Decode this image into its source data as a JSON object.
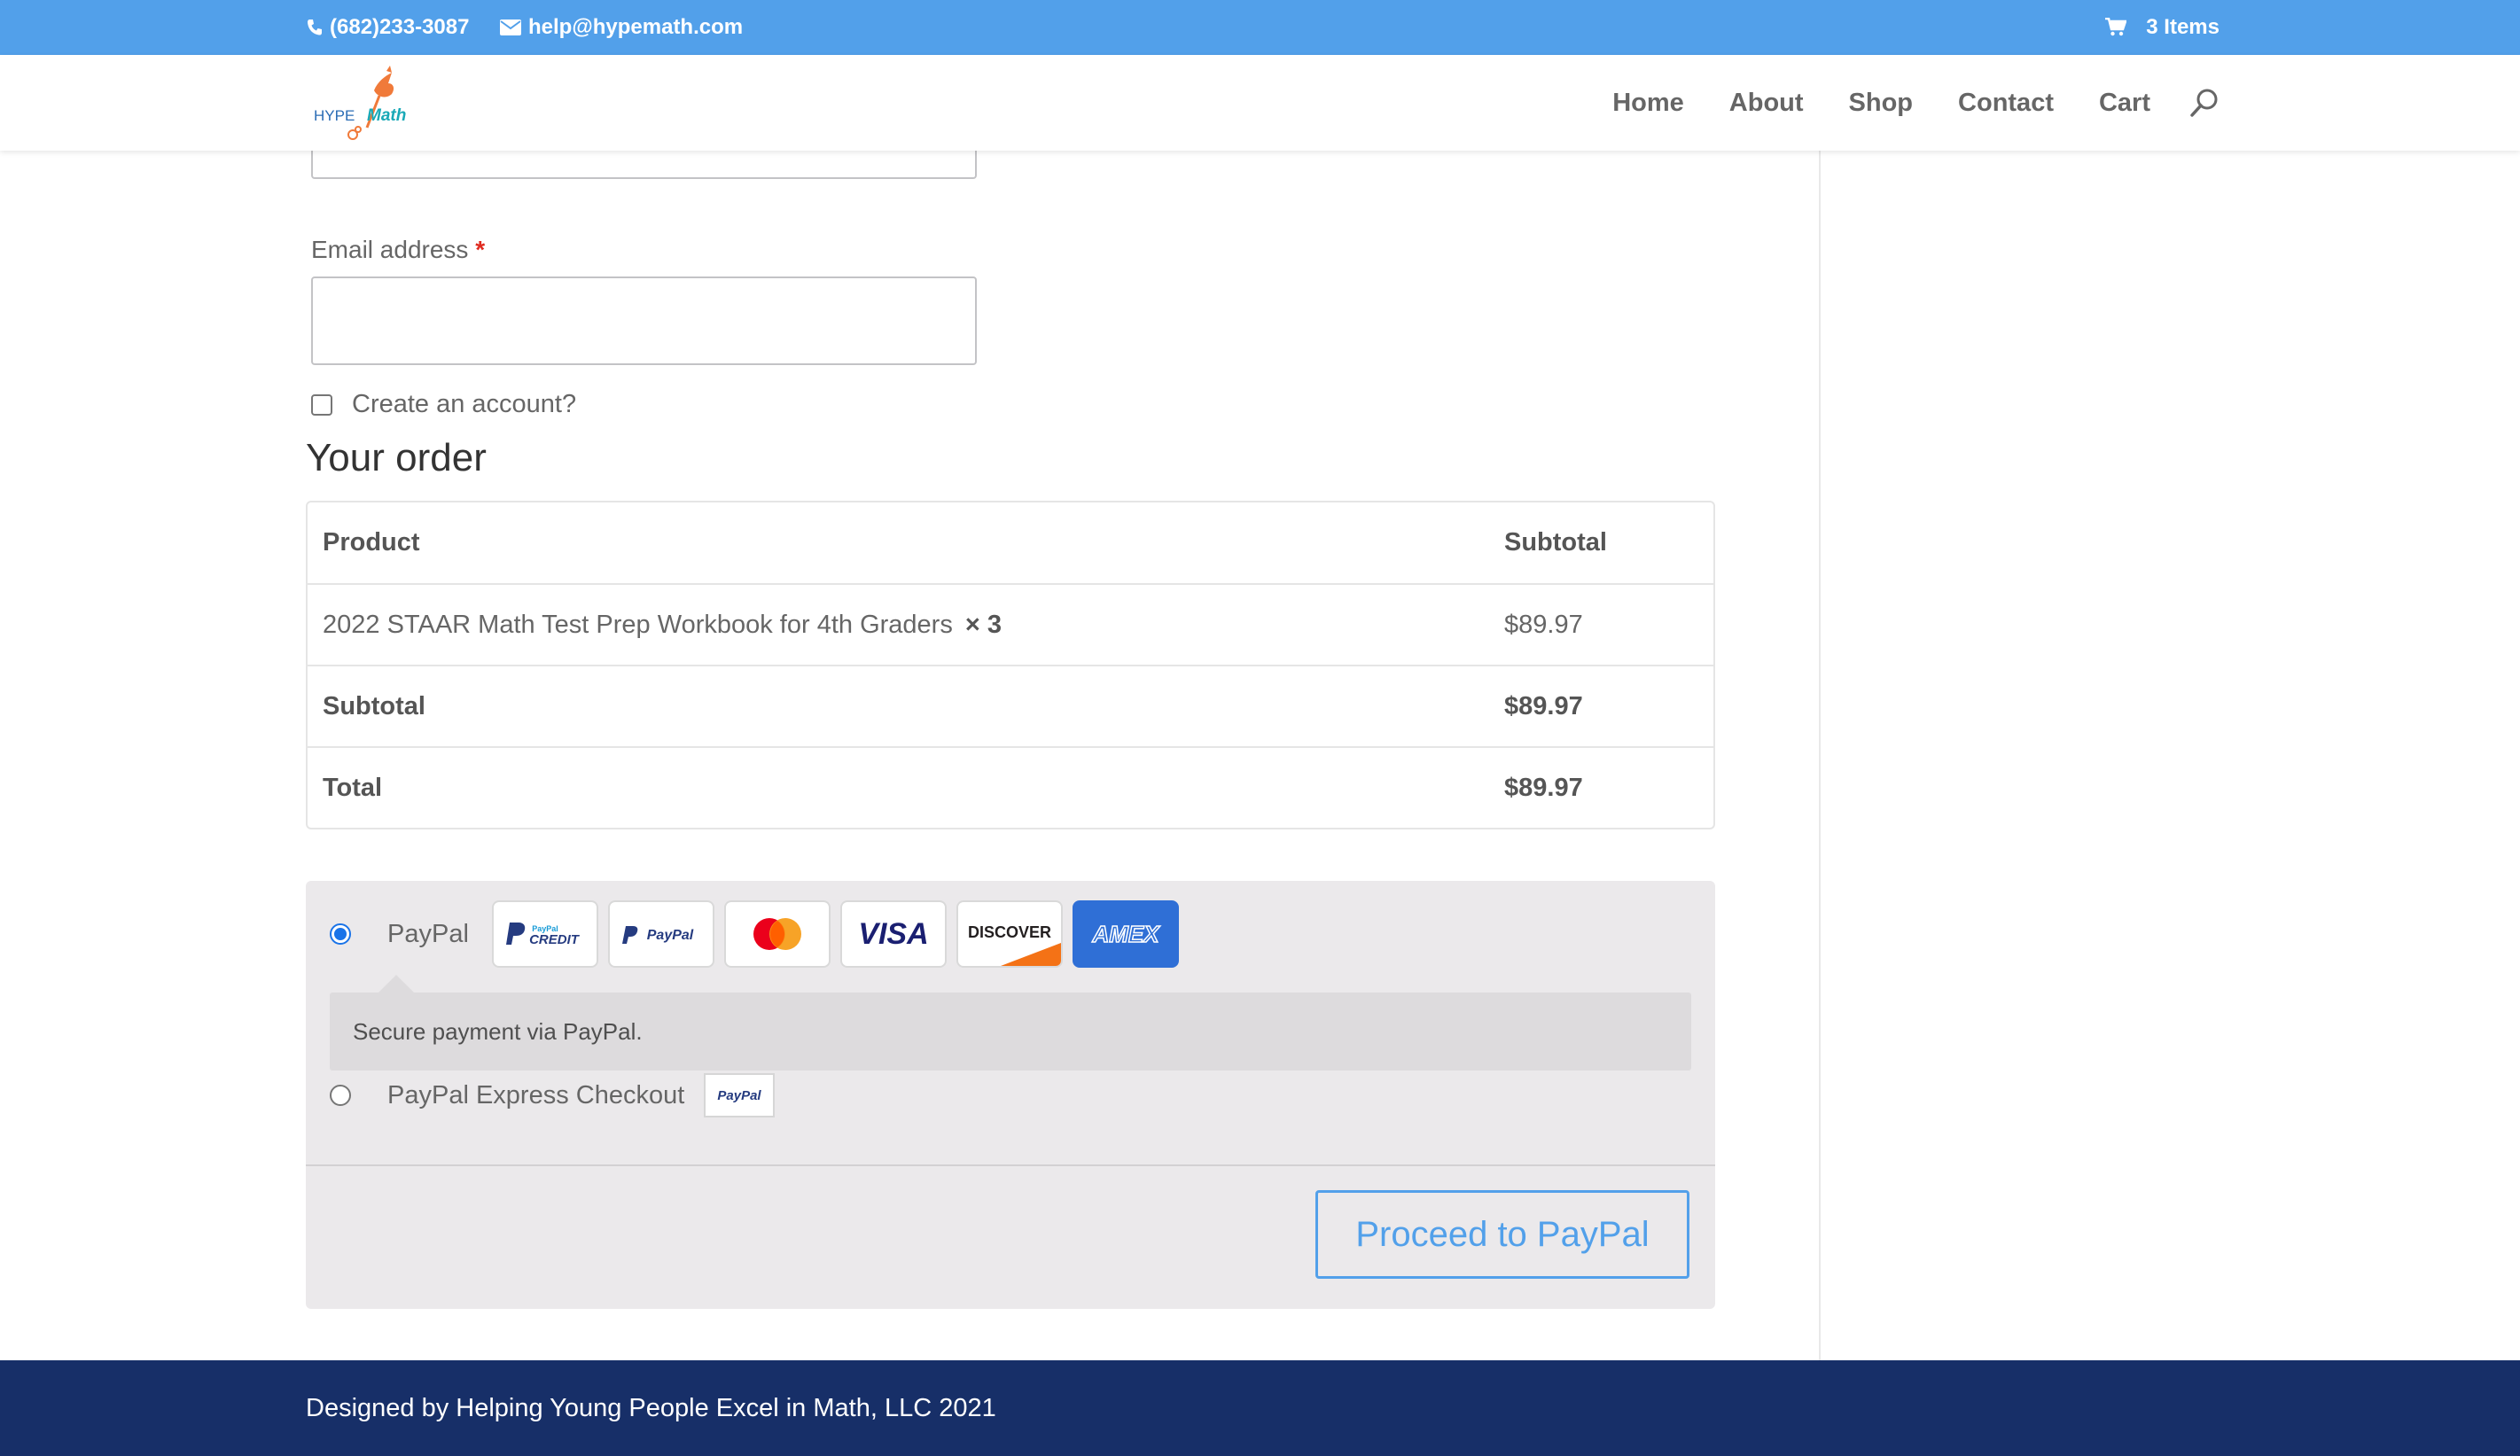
{
  "topbar": {
    "phone": "(682)233-3087",
    "email": "help@hypemath.com",
    "cart": "3 Items"
  },
  "header": {
    "logo_text_hype": "HYPE",
    "logo_text_math": "Math",
    "nav": [
      "Home",
      "About",
      "Shop",
      "Contact",
      "Cart"
    ]
  },
  "form": {
    "email_label": "Email address",
    "required_mark": "*",
    "email_value": "",
    "create_account_label": "Create an account?"
  },
  "order": {
    "title": "Your order",
    "header_product": "Product",
    "header_subtotal": "Subtotal",
    "item_name": "2022 STAAR Math Test Prep Workbook for 4th Graders",
    "item_qty": "× 3",
    "item_subtotal": "$89.97",
    "subtotal_label": "Subtotal",
    "subtotal_value": "$89.97",
    "total_label": "Total",
    "total_value": "$89.97"
  },
  "payment": {
    "method_1": "PayPal",
    "method_1_selected": true,
    "description": "Secure payment via PayPal.",
    "method_2": "PayPal Express Checkout",
    "proceed": "Proceed to PayPal",
    "card_icons": [
      "paypal-credit-icon",
      "paypal-icon",
      "mastercard-icon",
      "visa-icon",
      "discover-icon",
      "amex-icon"
    ],
    "card_labels": {
      "paypal_credit_top": "PayPal",
      "paypal_credit": "CREDIT",
      "paypal": "PayPal",
      "visa": "VISA",
      "discover": "DISCOVER",
      "amex": "AMEX",
      "paypal_mini": "PayPal"
    }
  },
  "footer": {
    "text": "Designed by Helping Young People Excel in Math, LLC 2021"
  },
  "colors": {
    "topbar": "#52a0ea",
    "accent": "#52a0ea",
    "footer": "#172f68",
    "required": "#e02b20"
  }
}
